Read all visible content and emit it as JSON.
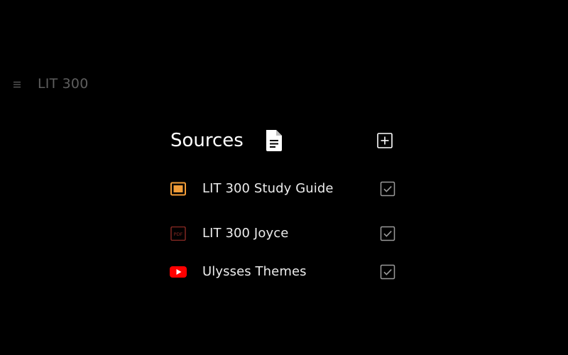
{
  "header": {
    "menu_icon": "menu-icon",
    "notebook_title": "LIT 300"
  },
  "sources": {
    "title": "Sources",
    "title_icon": "document-icon",
    "add_icon": "add-box-icon",
    "items": [
      {
        "label": "LIT 300 Study Guide",
        "type_icon": "slides-icon",
        "icon_color": "#f29d38",
        "checked": true
      },
      {
        "label": "LIT 300 Joyce",
        "type_icon": "pdf-icon",
        "icon_color": "#8b2a24",
        "pdf_badge": "PDF",
        "checked": true
      },
      {
        "label": "Ulysses Themes",
        "type_icon": "youtube-icon",
        "icon_color": "#ff0000",
        "checked": true
      }
    ]
  },
  "colors": {
    "background": "#000000",
    "title_dim": "#5e5e5e",
    "text": "#ececec",
    "checkbox": "#9a9a9a"
  }
}
